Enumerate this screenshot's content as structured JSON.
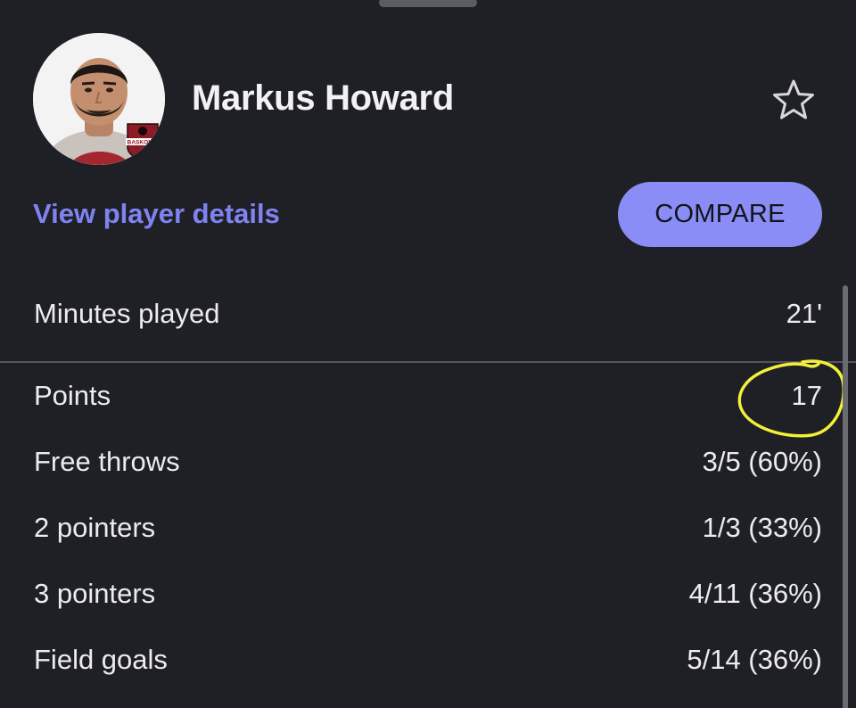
{
  "player": {
    "name": "Markus Howard",
    "team_badge": "BASKONIA"
  },
  "actions": {
    "details_label": "View player details",
    "compare_label": "COMPARE",
    "favorite_icon": "star-outline-icon"
  },
  "stats": [
    {
      "label": "Minutes played",
      "value": "21'"
    },
    {
      "label": "Points",
      "value": "17"
    },
    {
      "label": "Free throws",
      "value": "3/5 (60%)"
    },
    {
      "label": "2 pointers",
      "value": "1/3 (33%)"
    },
    {
      "label": "3 pointers",
      "value": "4/11 (36%)"
    },
    {
      "label": "Field goals",
      "value": "5/14 (36%)"
    }
  ],
  "colors": {
    "background": "#1f2025",
    "accent": "#8a8df5",
    "link": "#7f83f2",
    "annotation": "#f2f03a"
  }
}
